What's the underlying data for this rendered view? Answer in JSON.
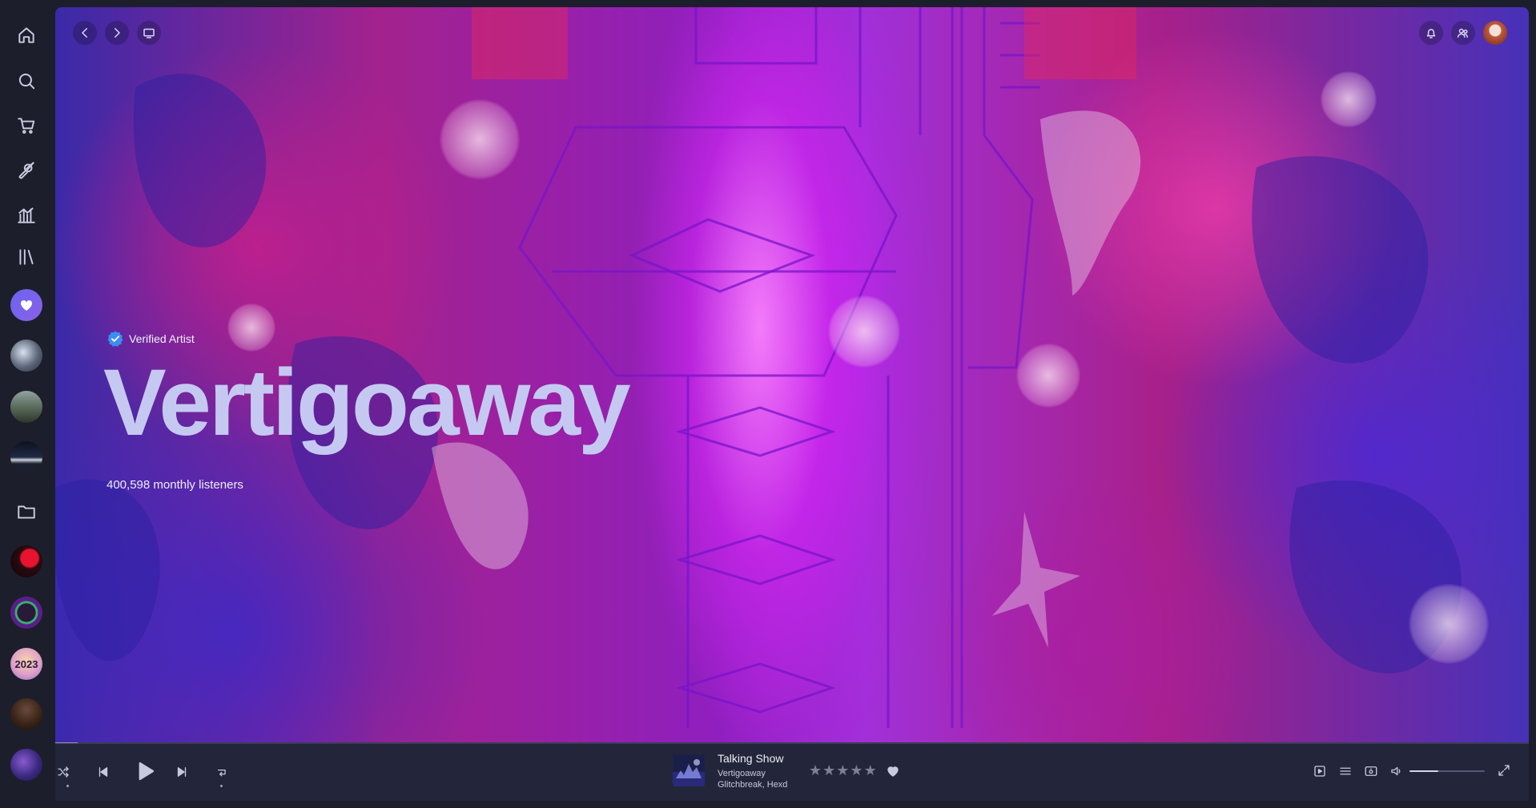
{
  "sidebar": {
    "nav": [
      {
        "name": "home-icon"
      },
      {
        "name": "search-icon"
      },
      {
        "name": "cart-icon"
      },
      {
        "name": "brush-icon"
      },
      {
        "name": "stats-icon"
      },
      {
        "name": "library-icon"
      }
    ],
    "liked_songs_icon": "heart-icon",
    "folder_icon": "folder-icon",
    "playlist_avatars": 9
  },
  "hero": {
    "verified_label": "Verified Artist",
    "artist_name": "Vertigoaway",
    "monthly_listeners": "400,598 monthly listeners"
  },
  "topbar": {
    "back_icon": "chevron-left-icon",
    "forward_icon": "chevron-right-icon",
    "miniplayer_icon": "monitor-icon",
    "notifications_icon": "bell-icon",
    "friends_icon": "friends-icon"
  },
  "player": {
    "track_title": "Talking Show",
    "track_artist": "Vertigoaway",
    "track_album": "Glitchbreak, Hexd",
    "rating": "★★★★★",
    "progress": 0.015,
    "volume": 0.38
  },
  "colors": {
    "background": "#1c1e2b",
    "player_bar": "#23263a",
    "artist_name": "#c5c9f2",
    "verified_blue": "#3d8cf0"
  }
}
